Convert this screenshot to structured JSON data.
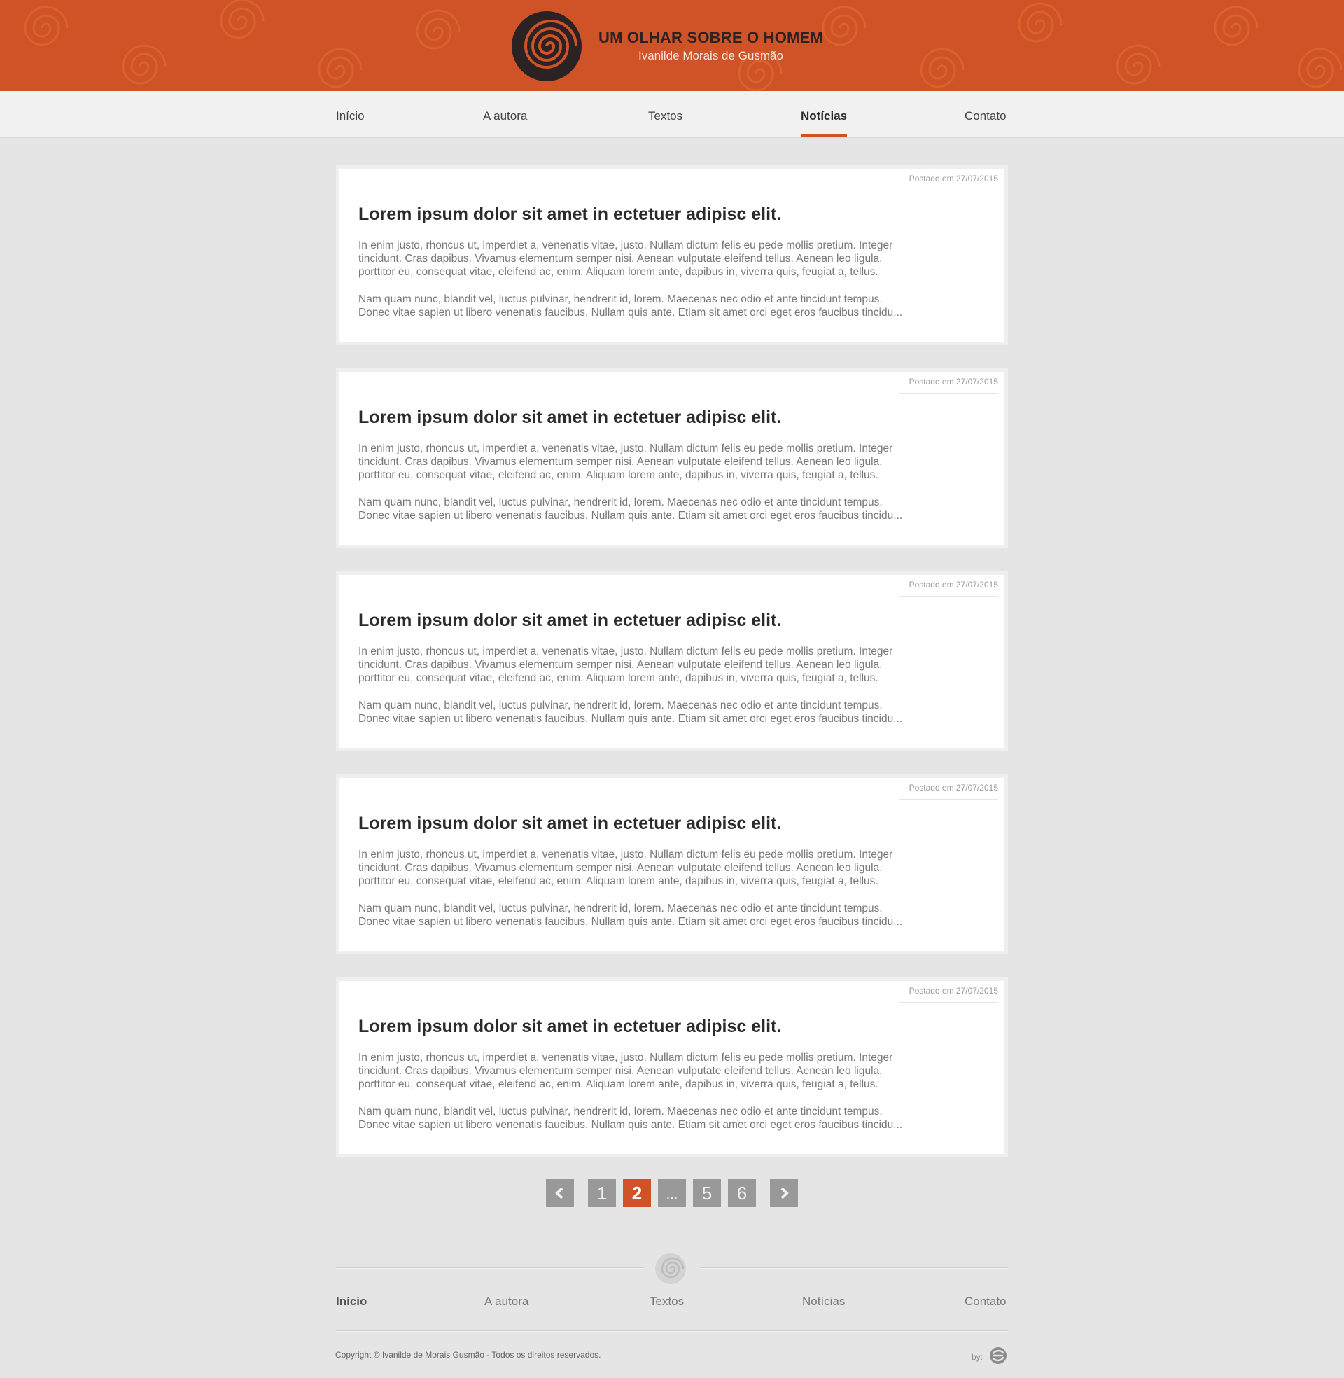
{
  "header": {
    "site_title": "UM OLHAR SOBRE O HOMEM",
    "site_subtitle": "Ivanilde Morais de Gusmão",
    "logo_icon": "spiral-logo-icon"
  },
  "nav": {
    "items": [
      {
        "label": "Início"
      },
      {
        "label": "A autora"
      },
      {
        "label": "Textos"
      },
      {
        "label": "Notícias",
        "active": true
      },
      {
        "label": "Contato"
      }
    ]
  },
  "posts": [
    {
      "date": "Postado em 27/07/2015",
      "title": "Lorem ipsum dolor sit amet in ectetuer adipisc elit.",
      "para1_lines": [
        "In enim justo, rhoncus ut, imperdiet a, venenatis vitae, justo. Nullam dictum felis eu pede mollis pretium. Integer",
        "tincidunt. Cras dapibus. Vivamus elementum semper nisi. Aenean vulputate eleifend tellus. Aenean leo ligula,",
        "porttitor eu, consequat vitae, eleifend ac, enim. Aliquam lorem ante, dapibus in, viverra quis, feugiat a, tellus."
      ],
      "para2_lines": [
        "Nam quam nunc, blandit vel, luctus pulvinar, hendrerit id, lorem. Maecenas nec odio et ante tincidunt tempus.",
        "Donec vitae sapien ut libero venenatis faucibus. Nullam quis ante. Etiam sit amet orci eget eros faucibus tincidu..."
      ]
    },
    {
      "date": "Postado em 27/07/2015",
      "title": "Lorem ipsum dolor sit amet in ectetuer adipisc elit.",
      "para1_lines": [
        "In enim justo, rhoncus ut, imperdiet a, venenatis vitae, justo. Nullam dictum felis eu pede mollis pretium. Integer",
        "tincidunt. Cras dapibus. Vivamus elementum semper nisi. Aenean vulputate eleifend tellus. Aenean leo ligula,",
        "porttitor eu, consequat vitae, eleifend ac, enim. Aliquam lorem ante, dapibus in, viverra quis, feugiat a, tellus."
      ],
      "para2_lines": [
        "Nam quam nunc, blandit vel, luctus pulvinar, hendrerit id, lorem. Maecenas nec odio et ante tincidunt tempus.",
        "Donec vitae sapien ut libero venenatis faucibus. Nullam quis ante. Etiam sit amet orci eget eros faucibus tincidu..."
      ]
    },
    {
      "date": "Postado em 27/07/2015",
      "title": "Lorem ipsum dolor sit amet in ectetuer adipisc elit.",
      "para1_lines": [
        "In enim justo, rhoncus ut, imperdiet a, venenatis vitae, justo. Nullam dictum felis eu pede mollis pretium. Integer",
        "tincidunt. Cras dapibus. Vivamus elementum semper nisi. Aenean vulputate eleifend tellus. Aenean leo ligula,",
        "porttitor eu, consequat vitae, eleifend ac, enim. Aliquam lorem ante, dapibus in, viverra quis, feugiat a, tellus."
      ],
      "para2_lines": [
        "Nam quam nunc, blandit vel, luctus pulvinar, hendrerit id, lorem. Maecenas nec odio et ante tincidunt tempus.",
        "Donec vitae sapien ut libero venenatis faucibus. Nullam quis ante. Etiam sit amet orci eget eros faucibus tincidu..."
      ]
    },
    {
      "date": "Postado em 27/07/2015",
      "title": "Lorem ipsum dolor sit amet in ectetuer adipisc elit.",
      "para1_lines": [
        "In enim justo, rhoncus ut, imperdiet a, venenatis vitae, justo. Nullam dictum felis eu pede mollis pretium. Integer",
        "tincidunt. Cras dapibus. Vivamus elementum semper nisi. Aenean vulputate eleifend tellus. Aenean leo ligula,",
        "porttitor eu, consequat vitae, eleifend ac, enim. Aliquam lorem ante, dapibus in, viverra quis, feugiat a, tellus."
      ],
      "para2_lines": [
        "Nam quam nunc, blandit vel, luctus pulvinar, hendrerit id, lorem. Maecenas nec odio et ante tincidunt tempus.",
        "Donec vitae sapien ut libero venenatis faucibus. Nullam quis ante. Etiam sit amet orci eget eros faucibus tincidu..."
      ]
    },
    {
      "date": "Postado em 27/07/2015",
      "title": "Lorem ipsum dolor sit amet in ectetuer adipisc elit.",
      "para1_lines": [
        "In enim justo, rhoncus ut, imperdiet a, venenatis vitae, justo. Nullam dictum felis eu pede mollis pretium. Integer",
        "tincidunt. Cras dapibus. Vivamus elementum semper nisi. Aenean vulputate eleifend tellus. Aenean leo ligula,",
        "porttitor eu, consequat vitae, eleifend ac, enim. Aliquam lorem ante, dapibus in, viverra quis, feugiat a, tellus."
      ],
      "para2_lines": [
        "Nam quam nunc, blandit vel, luctus pulvinar, hendrerit id, lorem. Maecenas nec odio et ante tincidunt tempus.",
        "Donec vitae sapien ut libero venenatis faucibus. Nullam quis ante. Etiam sit amet orci eget eros faucibus tincidu..."
      ]
    }
  ],
  "pagination": {
    "prev_icon": "chevron-left-icon",
    "next_icon": "chevron-right-icon",
    "pages": [
      "1",
      "2",
      "...",
      "5",
      "6"
    ],
    "current": "2"
  },
  "footer": {
    "logo_icon": "spiral-logo-icon",
    "links": [
      {
        "label": "Início",
        "active": true
      },
      {
        "label": "A autora"
      },
      {
        "label": "Textos"
      },
      {
        "label": "Notícias"
      },
      {
        "label": "Contato"
      }
    ],
    "copyright": "Copyright © Ivanilde de Morais Gusmão  - Todos os direitos reservados.",
    "by_label": "by:",
    "by_logo_icon": "agency-logo-icon"
  },
  "colors": {
    "accent": "#cf5326",
    "header_bg": "#cf5326",
    "page_bg": "#e5e5e5",
    "nav_bg": "#f1f1f1",
    "pager_bg": "#999999"
  }
}
